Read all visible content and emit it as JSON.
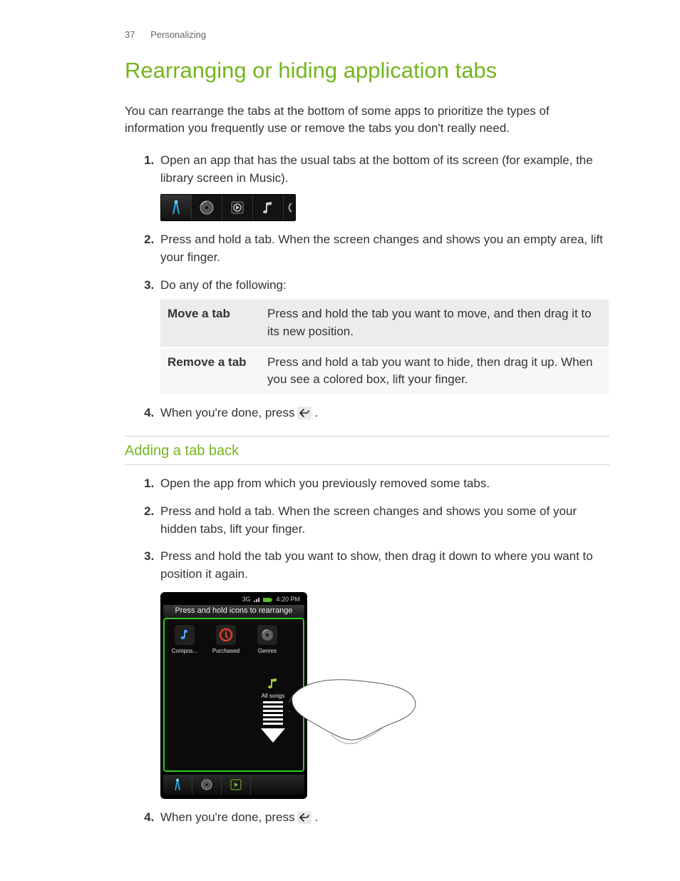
{
  "header": {
    "page_number": "37",
    "section": "Personalizing"
  },
  "title": "Rearranging or hiding application tabs",
  "intro": "You can rearrange the tabs at the bottom of some apps to prioritize the types of information you frequently use or remove the tabs you don't really need.",
  "steps": {
    "s1": "Open an app that has the usual tabs at the bottom of its screen (for example, the library screen in Music).",
    "s2": "Press and hold a tab. When the screen changes and shows you an empty area, lift your finger.",
    "s3": "Do any of the following:",
    "s4_pre": "When you're done, press ",
    "s4_post": "."
  },
  "table": {
    "r1k": "Move a tab",
    "r1v": "Press and hold the tab you want to move, and then drag it to its new position.",
    "r2k": "Remove a tab",
    "r2v": "Press and hold a tab you want to hide, then drag it up. When you see a colored box, lift your finger."
  },
  "sub_heading": "Adding a tab back",
  "sub_steps": {
    "a1": "Open the app from which you previously removed some tabs.",
    "a2": "Press and hold a tab. When the screen changes and shows you some of your hidden tabs, lift your finger.",
    "a3": "Press and hold the tab you want to show, then drag it down to where you want to position it again.",
    "a4_pre": "When you're done, press ",
    "a4_post": "."
  },
  "phone": {
    "time": "4:20 PM",
    "net": "3G",
    "hint": "Press and hold icons to rearrange",
    "apps": {
      "a1": "Compos...",
      "a2": "Purchased",
      "a3": "Genres"
    },
    "drag_label": "All songs"
  }
}
